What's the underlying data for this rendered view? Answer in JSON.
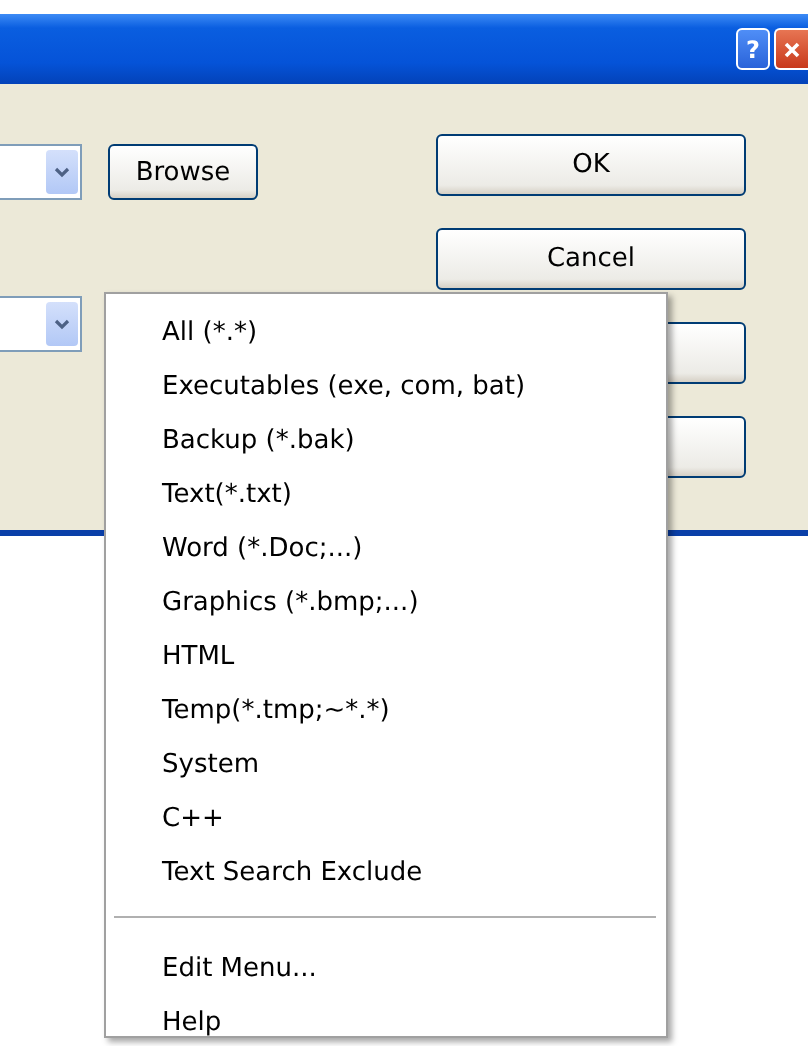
{
  "title_bar": {
    "help_button": "?"
  },
  "fields": [
    {
      "kind": "combo",
      "browse_button": "Browse"
    },
    {
      "kind": "combo"
    }
  ],
  "buttons": [
    {
      "kind": "push",
      "label": "OK"
    },
    {
      "kind": "push",
      "label": "Cancel"
    },
    {
      "kind": "covered"
    },
    {
      "kind": "covered"
    }
  ],
  "menu": [
    {
      "kind": "item",
      "label": "All (*.*)"
    },
    {
      "kind": "item",
      "label": "Executables (exe, com, bat)"
    },
    {
      "kind": "item",
      "label": "Backup (*.bak)"
    },
    {
      "kind": "item",
      "label": "Text(*.txt)"
    },
    {
      "kind": "item",
      "label": "Word (*.Doc;...)"
    },
    {
      "kind": "item",
      "label": "Graphics (*.bmp;...)"
    },
    {
      "kind": "item",
      "label": "HTML"
    },
    {
      "kind": "item",
      "label": "Temp(*.tmp;~*.*)"
    },
    {
      "kind": "item",
      "label": "System"
    },
    {
      "kind": "item",
      "label": "C++"
    },
    {
      "kind": "item",
      "label": "Text Search Exclude"
    },
    {
      "kind": "separator"
    },
    {
      "kind": "item",
      "label": "Edit Menu..."
    },
    {
      "kind": "item",
      "label": "Help"
    }
  ]
}
